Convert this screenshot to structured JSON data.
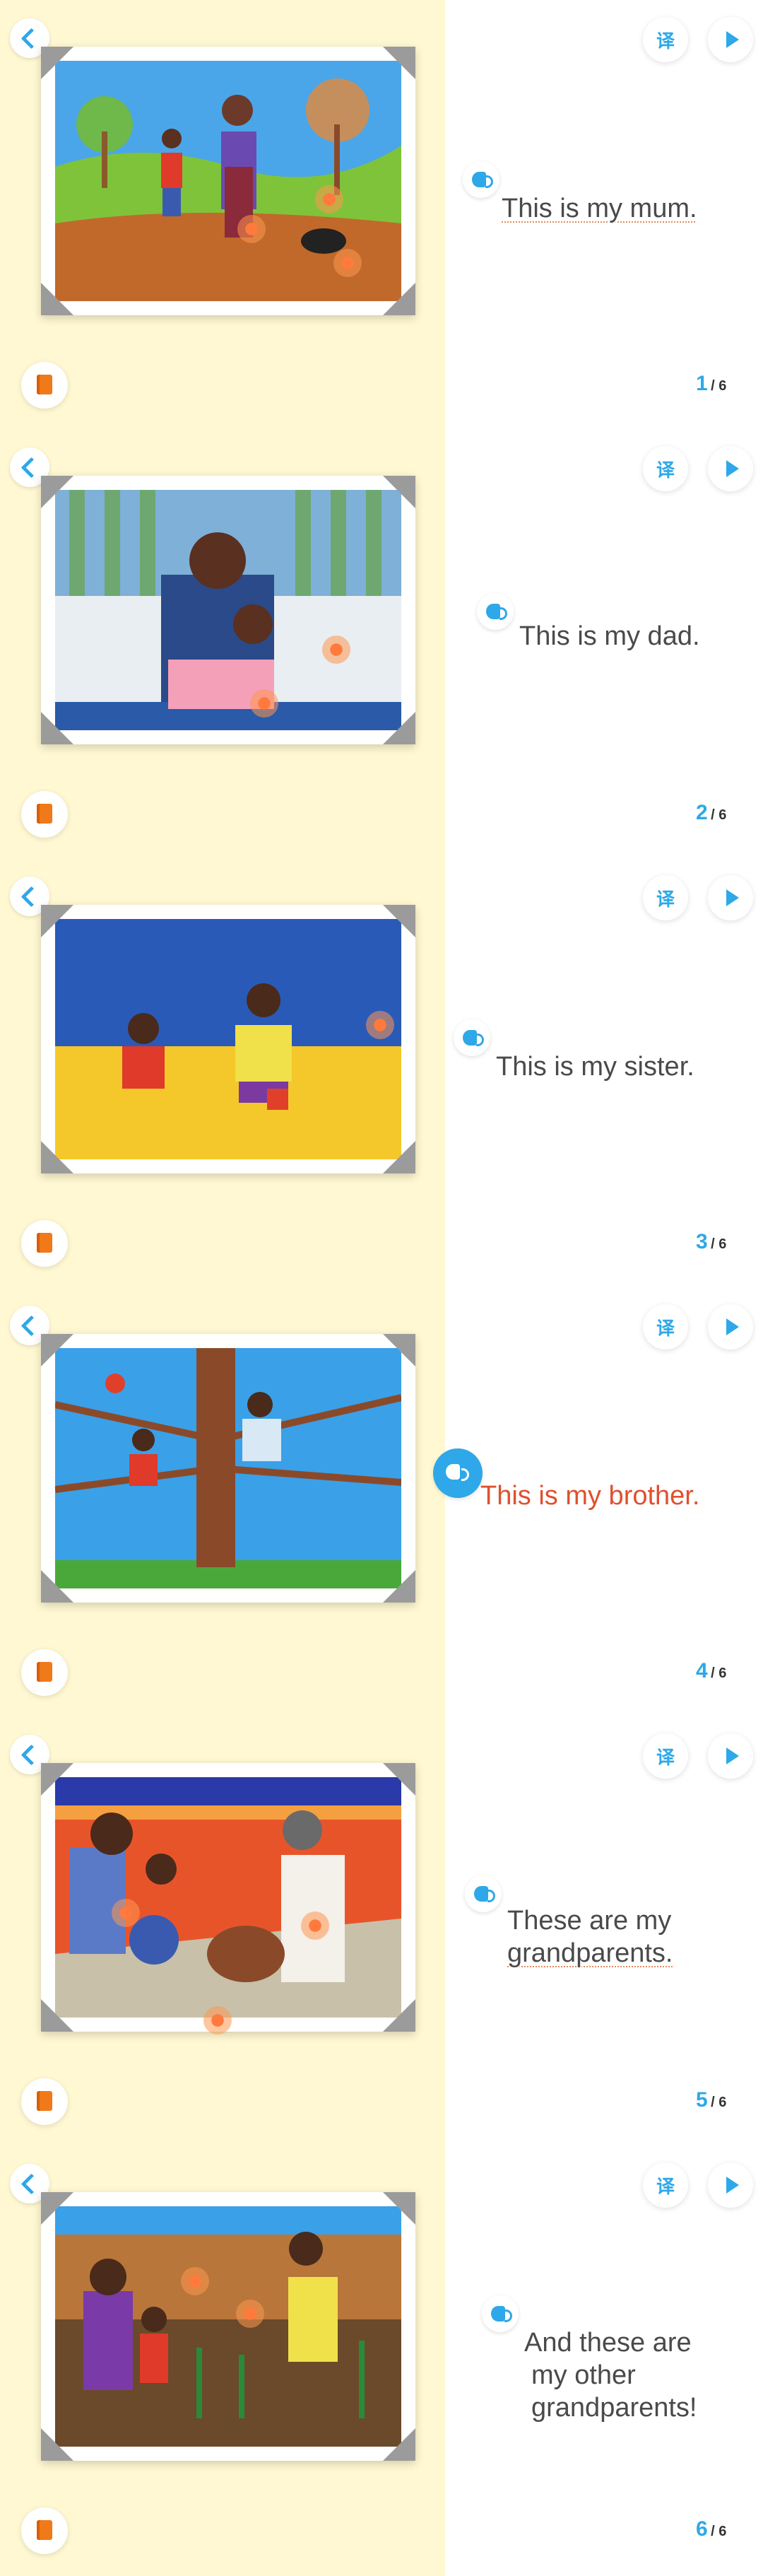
{
  "colors": {
    "accent": "#2ea8e8",
    "active_text": "#e0502e",
    "left_bg": "#fff8d2"
  },
  "controls": {
    "translate_label": "译",
    "back_icon": "chevron-left-icon",
    "play_icon": "play-icon",
    "speaker_icon": "speaker-icon",
    "book_icon": "book-icon"
  },
  "pages": [
    {
      "lines": [
        "This is my mum."
      ],
      "current": "1",
      "total": "/ 6",
      "active": false
    },
    {
      "lines": [
        "This is my dad."
      ],
      "current": "2",
      "total": "/ 6",
      "active": false
    },
    {
      "lines": [
        "This is my sister."
      ],
      "current": "3",
      "total": "/ 6",
      "active": false
    },
    {
      "lines": [
        "This is my brother."
      ],
      "current": "4",
      "total": "/ 6",
      "active": true
    },
    {
      "lines": [
        "These are my",
        "grandparents."
      ],
      "current": "5",
      "total": "/ 6",
      "active": false
    },
    {
      "lines": [
        "And these are",
        "my other",
        "grandparents!"
      ],
      "current": "6",
      "total": "/ 6",
      "active": false
    }
  ]
}
